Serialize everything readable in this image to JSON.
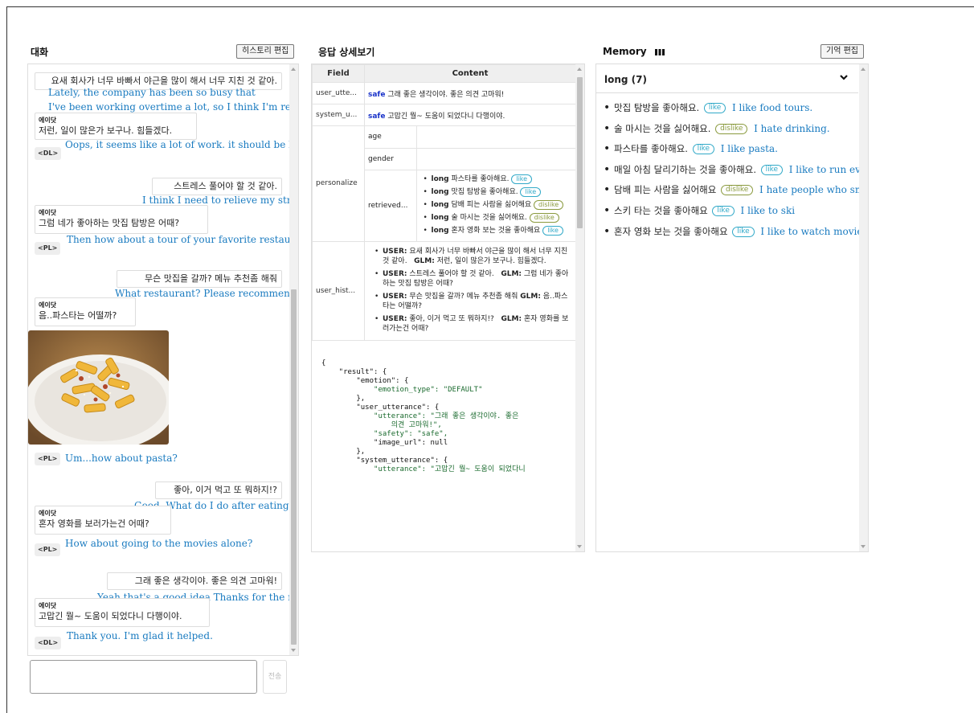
{
  "chat": {
    "title": "대화",
    "history_edit_label": "히스토리 편집",
    "send_label": "전송",
    "input_value": "",
    "messages": [
      {
        "role": "user",
        "text": "요새 회사가 너무 바빠서 야근을 많이 해서 너무 지친 것 같아.",
        "translation": "Lately, the company has been so busy that I've been working overtime a lot, so I think I'm really tired."
      },
      {
        "role": "bot",
        "name": "에이닷",
        "text": "저런, 일이 많은가 보구나. 힘들겠다.",
        "tag": "<DL>",
        "translation": "Oops, it seems like a lot of work. it should be hard."
      },
      {
        "role": "user",
        "text": "스트레스 풀어야 할 것 같아.",
        "translation": "I think I need to relieve my stress."
      },
      {
        "role": "bot",
        "name": "에이닷",
        "text": "그럼 네가 좋아하는 맛집 탐방은 어때?",
        "tag": "<PL>",
        "translation": "Then how about a tour of your favorite restaurant?"
      },
      {
        "role": "user",
        "text": "무슨 맛집을 갈까? 메뉴 추천좀 해줘",
        "translation": "What restaurant? Please recommend a menu"
      },
      {
        "role": "bot",
        "name": "에이닷",
        "text": "음..파스타는 어떨까?",
        "tag": "<PL>",
        "translation": "Um...how about pasta?"
      },
      {
        "role": "user",
        "text": "좋아, 이거 먹고 또 뭐하지!?",
        "translation": "Good. What do I do after eating this!?"
      },
      {
        "role": "bot",
        "name": "에이닷",
        "text": "혼자 영화를 보러가는건 어때?",
        "tag": "<PL>",
        "translation": "How about going to the movies alone?"
      },
      {
        "role": "user",
        "text": "그래 좋은 생각이야. 좋은 의견 고마워!",
        "translation": "Yeah that's a good idea Thanks for the nice comments!"
      },
      {
        "role": "bot",
        "name": "에이닷",
        "text": "고맙긴 뭘~ 도움이 되었다니 다행이야.",
        "tag": "<DL>",
        "translation": "Thank you. I'm glad it helped."
      }
    ]
  },
  "detail": {
    "title": "응답 상세보기",
    "headers": {
      "field": "Field",
      "content": "Content"
    },
    "user_utterance": {
      "field": "user_utte...",
      "safety": "safe",
      "text": "그래 좋은 생각이야. 좋은 의견 고마워!"
    },
    "system_utterance": {
      "field": "system_u...",
      "safety": "safe",
      "text": "고맙긴 뭘~ 도움이 되었다니 다행이야."
    },
    "personalize": {
      "field": "personalize",
      "age_label": "age",
      "gender_label": "gender",
      "retrieved_label": "retrieved...",
      "retrieved": [
        {
          "scope": "long",
          "text": "파스타를 좋아해요.",
          "sentiment": "like"
        },
        {
          "scope": "long",
          "text": "맛집 탐방을 좋아해요.",
          "sentiment": "like"
        },
        {
          "scope": "long",
          "text": "담배 피는 사람을 싫어해요",
          "sentiment": "dislike"
        },
        {
          "scope": "long",
          "text": "술 마시는 것을 싫어해요.",
          "sentiment": "dislike"
        },
        {
          "scope": "long",
          "text": "혼자 영화 보는 것을 좋아해요",
          "sentiment": "like"
        }
      ]
    },
    "user_history": {
      "field": "user_hist...",
      "user_label": "USER:",
      "bot_label": "GLM:",
      "items": [
        {
          "user": "요새 회사가 너무 바빠서 야근을 많이 해서 너무 지친 것 같아.",
          "bot": "저런, 일이 많은가 보구나. 힘들겠다."
        },
        {
          "user": "스트레스 풀어야 할 것 같아.",
          "bot": "그럼 네가 좋아하는 맛집 탐방은 어때?"
        },
        {
          "user": "무슨 맛집을 갈까? 메뉴 추천좀 해줘",
          "bot": "음..파스타는 어떨까?"
        },
        {
          "user": "좋아, 이거 먹고 또 뭐하지!?",
          "bot": "혼자 영화를 보러가는건 어때?"
        }
      ]
    },
    "json_lines": [
      "{",
      "    \"result\": {",
      "        \"emotion\": {",
      "            \"emotion_type\": \"DEFAULT\"",
      "        },",
      "        \"user_utterance\": {",
      "            \"utterance\": \"그래 좋은 생각이야. 좋은",
      "                의견 고마워!\",",
      "            \"safety\": \"safe\",",
      "            \"image_url\": null",
      "        },",
      "        \"system_utterance\": {",
      "            \"utterance\": \"고맙긴 뭘~ 도움이 되었다니"
    ]
  },
  "memory": {
    "title": "Memory",
    "edit_label": "기억 편집",
    "section_label": "long (7)",
    "items": [
      {
        "text": "맛집 탐방을 좋아해요.",
        "sentiment": "like",
        "translation": "I like food tours."
      },
      {
        "text": "술 마시는 것을 싫어해요.",
        "sentiment": "dislike",
        "translation": "I hate drinking."
      },
      {
        "text": "파스타를 좋아해요.",
        "sentiment": "like",
        "translation": "I like pasta."
      },
      {
        "text": "매일 아침 달리기하는 것을 좋아해요.",
        "sentiment": "like",
        "translation": "I like to run every morning."
      },
      {
        "text": "담배 피는 사람을 싫어해요",
        "sentiment": "dislike",
        "translation": "I hate people who smoke"
      },
      {
        "text": "스키 타는 것을 좋아해요",
        "sentiment": "like",
        "translation": "I like to ski"
      },
      {
        "text": "혼자 영화 보는 것을 좋아해요",
        "sentiment": "like",
        "translation": "I like to watch movies alone"
      }
    ]
  },
  "colors": {
    "translation": "#1a7bc0",
    "safe": "#1a33c9",
    "like": "#31a9c8",
    "dislike": "#8a9a3e"
  }
}
